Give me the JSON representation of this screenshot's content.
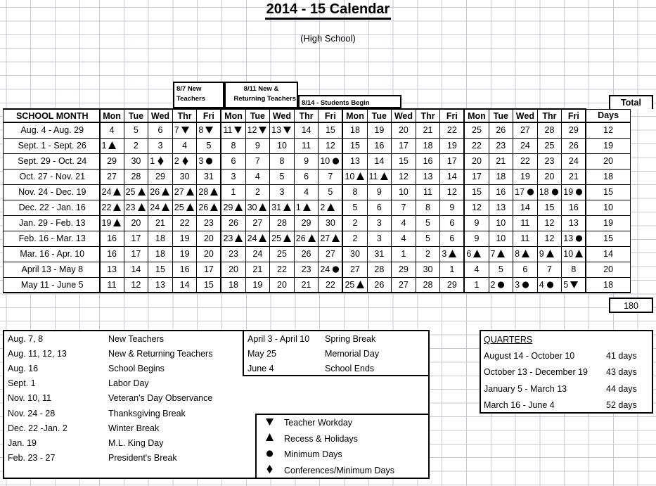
{
  "title": "2014 - 15   Calendar",
  "subtitle": "(High School)",
  "callouts": {
    "new_teachers_line1": "8/7   New",
    "new_teachers_line2": "Teachers",
    "returning_line1": "8/11  New &",
    "returning_line2": "Returning Teachers",
    "students_begin": "8/14  - Students Begin"
  },
  "table": {
    "header": {
      "school_month": "SCHOOL MONTH",
      "days": [
        "Mon",
        "Tue",
        "Wed",
        "Thr",
        "Fri",
        "Mon",
        "Tue",
        "Wed",
        "Thr",
        "Fri",
        "Mon",
        "Tue",
        "Wed",
        "Thr",
        "Fri",
        "Mon",
        "Tue",
        "Wed",
        "Thr",
        "Fri"
      ],
      "total_line1": "Total",
      "total_line2": "Days"
    },
    "rows": [
      {
        "month": "Aug. 4 - Aug. 29",
        "cells": [
          {
            "n": "4"
          },
          {
            "n": "5"
          },
          {
            "n": "6"
          },
          {
            "n": "7",
            "s": "down"
          },
          {
            "n": "8",
            "s": "down"
          },
          {
            "n": "11",
            "s": "down"
          },
          {
            "n": "12",
            "s": "down"
          },
          {
            "n": "13",
            "s": "down"
          },
          {
            "n": "14"
          },
          {
            "n": "15"
          },
          {
            "n": "18"
          },
          {
            "n": "19"
          },
          {
            "n": "20"
          },
          {
            "n": "21"
          },
          {
            "n": "22"
          },
          {
            "n": "25"
          },
          {
            "n": "26"
          },
          {
            "n": "27"
          },
          {
            "n": "28"
          },
          {
            "n": "29"
          }
        ],
        "total": "12"
      },
      {
        "month": "Sept. 1 - Sept. 26",
        "cells": [
          {
            "n": "1",
            "s": "up"
          },
          {
            "n": "2"
          },
          {
            "n": "3"
          },
          {
            "n": "4"
          },
          {
            "n": "5"
          },
          {
            "n": "8"
          },
          {
            "n": "9"
          },
          {
            "n": "10"
          },
          {
            "n": "11"
          },
          {
            "n": "12"
          },
          {
            "n": "15"
          },
          {
            "n": "16"
          },
          {
            "n": "17"
          },
          {
            "n": "18"
          },
          {
            "n": "19"
          },
          {
            "n": "22"
          },
          {
            "n": "23"
          },
          {
            "n": "24"
          },
          {
            "n": "25"
          },
          {
            "n": "26"
          }
        ],
        "total": "19"
      },
      {
        "month": "Sept. 29 - Oct. 24",
        "cells": [
          {
            "n": "29"
          },
          {
            "n": "30"
          },
          {
            "n": "1",
            "s": "diamond"
          },
          {
            "n": "2",
            "s": "diamond"
          },
          {
            "n": "3",
            "s": "circle"
          },
          {
            "n": "6"
          },
          {
            "n": "7"
          },
          {
            "n": "8"
          },
          {
            "n": "9"
          },
          {
            "n": "10",
            "s": "circle"
          },
          {
            "n": "13"
          },
          {
            "n": "14"
          },
          {
            "n": "15"
          },
          {
            "n": "16"
          },
          {
            "n": "17"
          },
          {
            "n": "20"
          },
          {
            "n": "21"
          },
          {
            "n": "22"
          },
          {
            "n": "23"
          },
          {
            "n": "24"
          }
        ],
        "total": "20"
      },
      {
        "month": "Oct. 27 - Nov. 21",
        "cells": [
          {
            "n": "27"
          },
          {
            "n": "28"
          },
          {
            "n": "29"
          },
          {
            "n": "30"
          },
          {
            "n": "31"
          },
          {
            "n": "3"
          },
          {
            "n": "4"
          },
          {
            "n": "5"
          },
          {
            "n": "6"
          },
          {
            "n": "7"
          },
          {
            "n": "10",
            "s": "up"
          },
          {
            "n": "11",
            "s": "up"
          },
          {
            "n": "12"
          },
          {
            "n": "13"
          },
          {
            "n": "14"
          },
          {
            "n": "17"
          },
          {
            "n": "18"
          },
          {
            "n": "19"
          },
          {
            "n": "20"
          },
          {
            "n": "21"
          }
        ],
        "total": "18"
      },
      {
        "month": "Nov. 24 - Dec. 19",
        "cells": [
          {
            "n": "24",
            "s": "up"
          },
          {
            "n": "25",
            "s": "up"
          },
          {
            "n": "26",
            "s": "up"
          },
          {
            "n": "27",
            "s": "up"
          },
          {
            "n": "28",
            "s": "up"
          },
          {
            "n": "1"
          },
          {
            "n": "2"
          },
          {
            "n": "3"
          },
          {
            "n": "4"
          },
          {
            "n": "5"
          },
          {
            "n": "8"
          },
          {
            "n": "9"
          },
          {
            "n": "10"
          },
          {
            "n": "11"
          },
          {
            "n": "12"
          },
          {
            "n": "15"
          },
          {
            "n": "16"
          },
          {
            "n": "17",
            "s": "circle"
          },
          {
            "n": "18",
            "s": "circle"
          },
          {
            "n": "19",
            "s": "circle"
          }
        ],
        "total": "15"
      },
      {
        "month": "Dec. 22 - Jan. 16",
        "cells": [
          {
            "n": "22",
            "s": "up"
          },
          {
            "n": "23",
            "s": "up"
          },
          {
            "n": "24",
            "s": "up"
          },
          {
            "n": "25",
            "s": "up"
          },
          {
            "n": "26",
            "s": "up"
          },
          {
            "n": "29",
            "s": "up"
          },
          {
            "n": "30",
            "s": "up"
          },
          {
            "n": "31",
            "s": "up"
          },
          {
            "n": "1",
            "s": "up"
          },
          {
            "n": "2",
            "s": "up"
          },
          {
            "n": "5"
          },
          {
            "n": "6"
          },
          {
            "n": "7"
          },
          {
            "n": "8"
          },
          {
            "n": "9"
          },
          {
            "n": "12"
          },
          {
            "n": "13"
          },
          {
            "n": "14"
          },
          {
            "n": "15"
          },
          {
            "n": "16"
          }
        ],
        "total": "10"
      },
      {
        "month": "Jan. 29 - Feb. 13",
        "cells": [
          {
            "n": "19",
            "s": "up"
          },
          {
            "n": "20"
          },
          {
            "n": "21"
          },
          {
            "n": "22"
          },
          {
            "n": "23"
          },
          {
            "n": "26"
          },
          {
            "n": "27"
          },
          {
            "n": "28"
          },
          {
            "n": "29"
          },
          {
            "n": "30"
          },
          {
            "n": "2"
          },
          {
            "n": "3"
          },
          {
            "n": "4"
          },
          {
            "n": "5"
          },
          {
            "n": "6"
          },
          {
            "n": "9"
          },
          {
            "n": "10"
          },
          {
            "n": "11"
          },
          {
            "n": "12"
          },
          {
            "n": "13"
          }
        ],
        "total": "19"
      },
      {
        "month": "Feb. 16 - Mar. 13",
        "cells": [
          {
            "n": "16"
          },
          {
            "n": "17"
          },
          {
            "n": "18"
          },
          {
            "n": "19"
          },
          {
            "n": "20"
          },
          {
            "n": "23",
            "s": "up"
          },
          {
            "n": "24",
            "s": "up"
          },
          {
            "n": "25",
            "s": "up"
          },
          {
            "n": "26",
            "s": "up"
          },
          {
            "n": "27",
            "s": "up"
          },
          {
            "n": "2"
          },
          {
            "n": "3"
          },
          {
            "n": "4"
          },
          {
            "n": "5"
          },
          {
            "n": "6"
          },
          {
            "n": "9"
          },
          {
            "n": "10"
          },
          {
            "n": "11"
          },
          {
            "n": "12"
          },
          {
            "n": "13",
            "s": "circle"
          }
        ],
        "total": "15"
      },
      {
        "month": "Mar. 16 - Apr. 10",
        "cells": [
          {
            "n": "16"
          },
          {
            "n": "17"
          },
          {
            "n": "18"
          },
          {
            "n": "19"
          },
          {
            "n": "20"
          },
          {
            "n": "23"
          },
          {
            "n": "24"
          },
          {
            "n": "25"
          },
          {
            "n": "26"
          },
          {
            "n": "27"
          },
          {
            "n": "30"
          },
          {
            "n": "31"
          },
          {
            "n": "1"
          },
          {
            "n": "2"
          },
          {
            "n": "3",
            "s": "up"
          },
          {
            "n": "6",
            "s": "up"
          },
          {
            "n": "7",
            "s": "up"
          },
          {
            "n": "8",
            "s": "up"
          },
          {
            "n": "9",
            "s": "up"
          },
          {
            "n": "10",
            "s": "up"
          }
        ],
        "total": "14"
      },
      {
        "month": "April 13 - May 8",
        "cells": [
          {
            "n": "13"
          },
          {
            "n": "14"
          },
          {
            "n": "15"
          },
          {
            "n": "16"
          },
          {
            "n": "17"
          },
          {
            "n": "20"
          },
          {
            "n": "21"
          },
          {
            "n": "22"
          },
          {
            "n": "23"
          },
          {
            "n": "24",
            "s": "circle"
          },
          {
            "n": "27"
          },
          {
            "n": "28"
          },
          {
            "n": "29"
          },
          {
            "n": "30"
          },
          {
            "n": "1"
          },
          {
            "n": "4"
          },
          {
            "n": "5"
          },
          {
            "n": "6"
          },
          {
            "n": "7"
          },
          {
            "n": "8"
          }
        ],
        "total": "20"
      },
      {
        "month": "May 11 - June 5",
        "cells": [
          {
            "n": "11"
          },
          {
            "n": "12"
          },
          {
            "n": "13"
          },
          {
            "n": "14"
          },
          {
            "n": "15"
          },
          {
            "n": "18"
          },
          {
            "n": "19"
          },
          {
            "n": "20"
          },
          {
            "n": "21"
          },
          {
            "n": "22"
          },
          {
            "n": "25",
            "s": "up"
          },
          {
            "n": "26"
          },
          {
            "n": "27"
          },
          {
            "n": "28"
          },
          {
            "n": "29"
          },
          {
            "n": "1"
          },
          {
            "n": "2",
            "s": "circle"
          },
          {
            "n": "3",
            "s": "circle"
          },
          {
            "n": "4",
            "s": "circle"
          },
          {
            "n": "5",
            "s": "down"
          }
        ],
        "total": "18"
      }
    ],
    "grand_total": "180"
  },
  "events_left": [
    {
      "date": "Aug. 7, 8",
      "desc": "New Teachers"
    },
    {
      "date": "Aug. 11, 12, 13",
      "desc": "New & Returning Teachers"
    },
    {
      "date": "Aug. 16",
      "desc": "School Begins"
    },
    {
      "date": "Sept. 1",
      "desc": "Labor Day"
    },
    {
      "date": "Nov. 10, 11",
      "desc": "Veteran's Day Observance"
    },
    {
      "date": "Nov. 24 - 28",
      "desc": "Thanksgiving Break"
    },
    {
      "date": "Dec. 22 -Jan. 2",
      "desc": "Winter Break"
    },
    {
      "date": "Jan. 19",
      "desc": "M.L. King Day"
    },
    {
      "date": "Feb. 23 - 27",
      "desc": "President's Break"
    }
  ],
  "events_right": [
    {
      "date": "April 3 - April 10",
      "desc": "Spring Break"
    },
    {
      "date": "May 25",
      "desc": "Memorial Day"
    },
    {
      "date": "June 4",
      "desc": "School Ends"
    }
  ],
  "legend": [
    {
      "symbol": "down",
      "label": "Teacher Workday"
    },
    {
      "symbol": "up",
      "label": "Recess & Holidays"
    },
    {
      "symbol": "circle",
      "label": "Minimum Days"
    },
    {
      "symbol": "diamond",
      "label": "Conferences/Minimum Days"
    }
  ],
  "quarters": {
    "heading": "QUARTERS",
    "rows": [
      {
        "range": "August  14  -  October  10",
        "days": "41 days"
      },
      {
        "range": "October  13  -  December  19",
        "days": "43 days"
      },
      {
        "range": "January  5 - March 13",
        "days": "44 days"
      },
      {
        "range": "March  16 -  June 4",
        "days": "52 days"
      }
    ]
  },
  "colors": {
    "grid": "#c3cbd8",
    "border": "#000000",
    "text": "#000000",
    "background": "#ffffff"
  }
}
